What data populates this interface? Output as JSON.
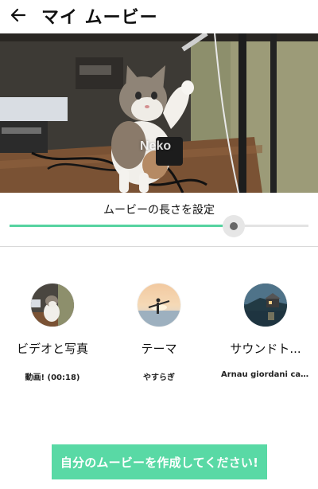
{
  "header": {
    "title": "マイ ムービー",
    "back_icon": "arrow-left-icon"
  },
  "preview": {
    "overlay_text": "Neko"
  },
  "length": {
    "label": "ムービーの長さを設定",
    "slider_value_fraction": 0.75
  },
  "options": [
    {
      "label": "ビデオと写真",
      "value": "動画! (00:18)",
      "thumb": "cat-thumbnail"
    },
    {
      "label": "テーマ",
      "value": "やすらぎ",
      "thumb": "surfer-sunset-thumbnail"
    },
    {
      "label": "サウンドト...",
      "value": "Arnau giordani cal...",
      "thumb": "cabin-lake-thumbnail"
    }
  ],
  "create_button": {
    "label": "自分のムービーを作成してください!"
  },
  "colors": {
    "accent": "#59d9a5",
    "slider_fill": "#56d3a0",
    "thumb": "#666666"
  }
}
